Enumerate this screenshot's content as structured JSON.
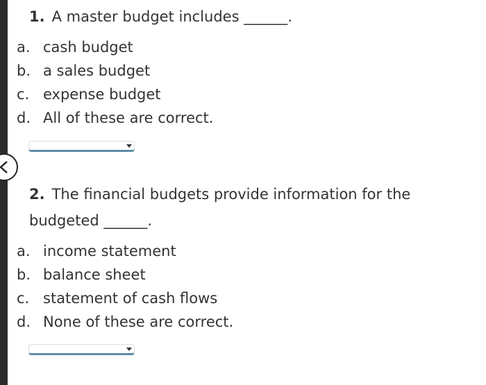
{
  "questions": [
    {
      "number": "1.",
      "text_lines": [
        "A master budget includes ______."
      ],
      "options": [
        {
          "letter": "a.",
          "text": "cash budget"
        },
        {
          "letter": "b.",
          "text": "a sales budget"
        },
        {
          "letter": "c.",
          "text": "expense budget"
        },
        {
          "letter": "d.",
          "text": "All of these are correct."
        }
      ],
      "answer_selected": ""
    },
    {
      "number": "2.",
      "text_lines": [
        "The financial budgets provide information for the",
        "budgeted ______."
      ],
      "options": [
        {
          "letter": "a.",
          "text": "income statement"
        },
        {
          "letter": "b.",
          "text": "balance sheet"
        },
        {
          "letter": "c.",
          "text": "statement of cash flows"
        },
        {
          "letter": "d.",
          "text": "None of these are correct."
        }
      ],
      "answer_selected": ""
    }
  ],
  "icons": {
    "back": "chevron-left-icon",
    "dropdown": "caret-down-icon"
  }
}
